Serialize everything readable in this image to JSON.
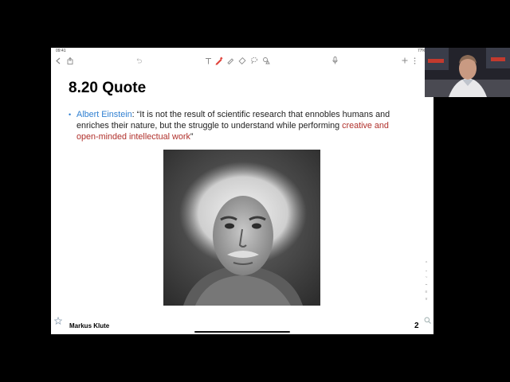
{
  "status_bar": {
    "time": "09:41",
    "battery": "77%"
  },
  "toolbar": {
    "icons": [
      "chevron-left-icon",
      "share-icon",
      "undo-icon",
      "text-tool-icon",
      "pen-icon",
      "highlighter-icon",
      "eraser-icon",
      "lasso-icon",
      "shapes-icon",
      "microphone-icon",
      "add-icon",
      "more-icon"
    ]
  },
  "slide": {
    "title": "8.20 Quote",
    "bullet": {
      "author": "Albert Einstein",
      "quote_main": ": “It is not the result of scientific research that ennobles humans and enriches their nature, but the struggle to understand while performing ",
      "quote_highlight": "creative and open-minded intellectual work",
      "quote_end": "”"
    },
    "footer_name": "Markus Klute",
    "page_number": "2"
  },
  "colors": {
    "accent_blue": "#2f7fd1",
    "highlight_red": "#b0302b",
    "pen_red": "#e0423a"
  }
}
